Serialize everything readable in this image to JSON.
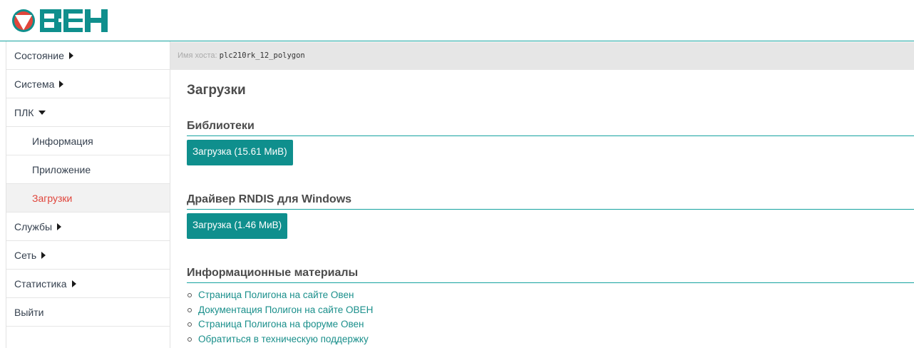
{
  "header": {
    "logo_text": "ОВЕН",
    "accent_color": "#16a3a0",
    "logo_color": "#0f8f8d",
    "logo_circle_color": "#e0453b"
  },
  "sidebar": {
    "items": [
      {
        "label": "Состояние",
        "expander": "caret-right"
      },
      {
        "label": "Система",
        "expander": "caret-right"
      },
      {
        "label": "ПЛК",
        "expander": "caret-down"
      },
      {
        "label": "Информация"
      },
      {
        "label": "Приложение"
      },
      {
        "label": "Загрузки",
        "active": true
      },
      {
        "label": "Службы",
        "expander": "caret-right"
      },
      {
        "label": "Сеть",
        "expander": "caret-right"
      },
      {
        "label": "Статистика",
        "expander": "caret-right"
      },
      {
        "label": "Выйти"
      }
    ]
  },
  "hostbar": {
    "label": "Имя хоста:",
    "value": "plc210rk_12_polygon"
  },
  "main": {
    "title": "Загрузки",
    "libraries": {
      "title": "Библиотеки",
      "button": "Загрузка (15.61 МиВ)"
    },
    "rndis": {
      "title": "Драйвер RNDIS для Windows",
      "button": "Загрузка (1.46 МиВ)"
    },
    "info": {
      "title": "Информационные материалы",
      "links": [
        "Страница Полигона на сайте Овен",
        "Документация Полигон на сайте ОВЕН",
        "Страница Полигона на форуме Овен",
        "Обратиться в техническую поддержку"
      ]
    }
  }
}
